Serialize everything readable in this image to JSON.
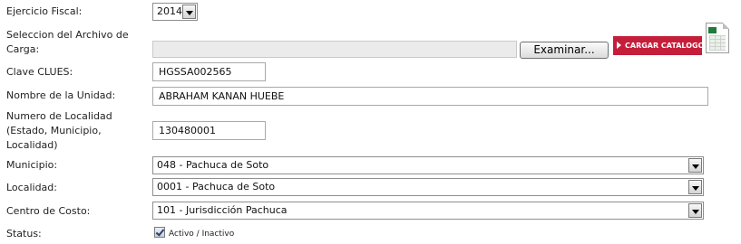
{
  "form": {
    "ejercicio": {
      "label": "Ejercicio Fiscal:",
      "value": "2014"
    },
    "archivo": {
      "label": "Seleccion del Archivo de Carga:",
      "file_value": "",
      "browse_label": "Examinar...",
      "upload_label": "CARGAR CATALOGO",
      "spreadsheet_icon": "excel-file-icon"
    },
    "clues": {
      "label": "Clave CLUES:",
      "value": "HGSSA002565"
    },
    "unidad": {
      "label": "Nombre de la Unidad:",
      "value": "ABRAHAM KANAN HUEBE"
    },
    "localidad_num": {
      "label": "Numero de Localidad (Estado, Municipio, Localidad)",
      "value": "130480001"
    },
    "municipio": {
      "label": "Municipio:",
      "value": "048 - Pachuca de Soto"
    },
    "localidad": {
      "label": "Localidad:",
      "value": "0001 - Pachuca de Soto"
    },
    "centro": {
      "label": "Centro de Costo:",
      "value": "101 - Jurisdicción Pachuca"
    },
    "status": {
      "label": "Status:",
      "checkbox_label": "Activo / Inactivo",
      "checked": true
    }
  },
  "colors": {
    "accent": "#c41e3a",
    "disabled_field": "#ebebeb"
  }
}
